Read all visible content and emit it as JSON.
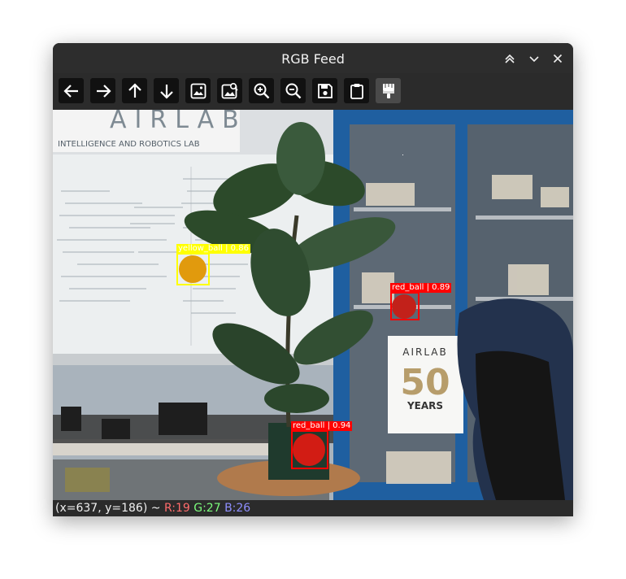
{
  "window": {
    "title": "RGB Feed",
    "controls": [
      "chevrons-up-icon",
      "chevron-down-icon",
      "close-icon"
    ]
  },
  "toolbar": {
    "buttons": [
      {
        "name": "back",
        "icon": "arrow-left-icon"
      },
      {
        "name": "forward",
        "icon": "arrow-right-icon"
      },
      {
        "name": "up",
        "icon": "arrow-up-icon"
      },
      {
        "name": "down",
        "icon": "arrow-down-icon"
      },
      {
        "name": "image",
        "icon": "image-icon"
      },
      {
        "name": "image-search",
        "icon": "image-search-icon"
      },
      {
        "name": "zoom-in",
        "icon": "zoom-in-icon"
      },
      {
        "name": "zoom-out",
        "icon": "zoom-out-icon"
      },
      {
        "name": "save",
        "icon": "save-icon"
      },
      {
        "name": "clipboard",
        "icon": "clipboard-icon"
      },
      {
        "name": "brush",
        "icon": "paintbrush-icon"
      }
    ]
  },
  "detections": [
    {
      "label": "yellow_ball | 0.86",
      "color": "#ffff00",
      "text_color": "#ffffff"
    },
    {
      "label": "red_ball | 0.89",
      "color": "#ff0000",
      "text_color": "#ffffff"
    },
    {
      "label": "red_ball | 0.94",
      "color": "#ff0000",
      "text_color": "#ffffff"
    }
  ],
  "scene": {
    "lab_sign": "AIRLAB",
    "lab_subtitle": "INTELLIGENCE AND ROBOTICS LAB",
    "poster": {
      "top": "AIRLAB",
      "number": "50",
      "bottom": "YEARS"
    }
  },
  "status": {
    "coords": "(x=637, y=186) ~ ",
    "r": "R:19",
    "g": "G:27",
    "b": "B:26",
    "r_color": "#ff6b6b",
    "g_color": "#7cfc7c",
    "b_color": "#8f8fff"
  }
}
